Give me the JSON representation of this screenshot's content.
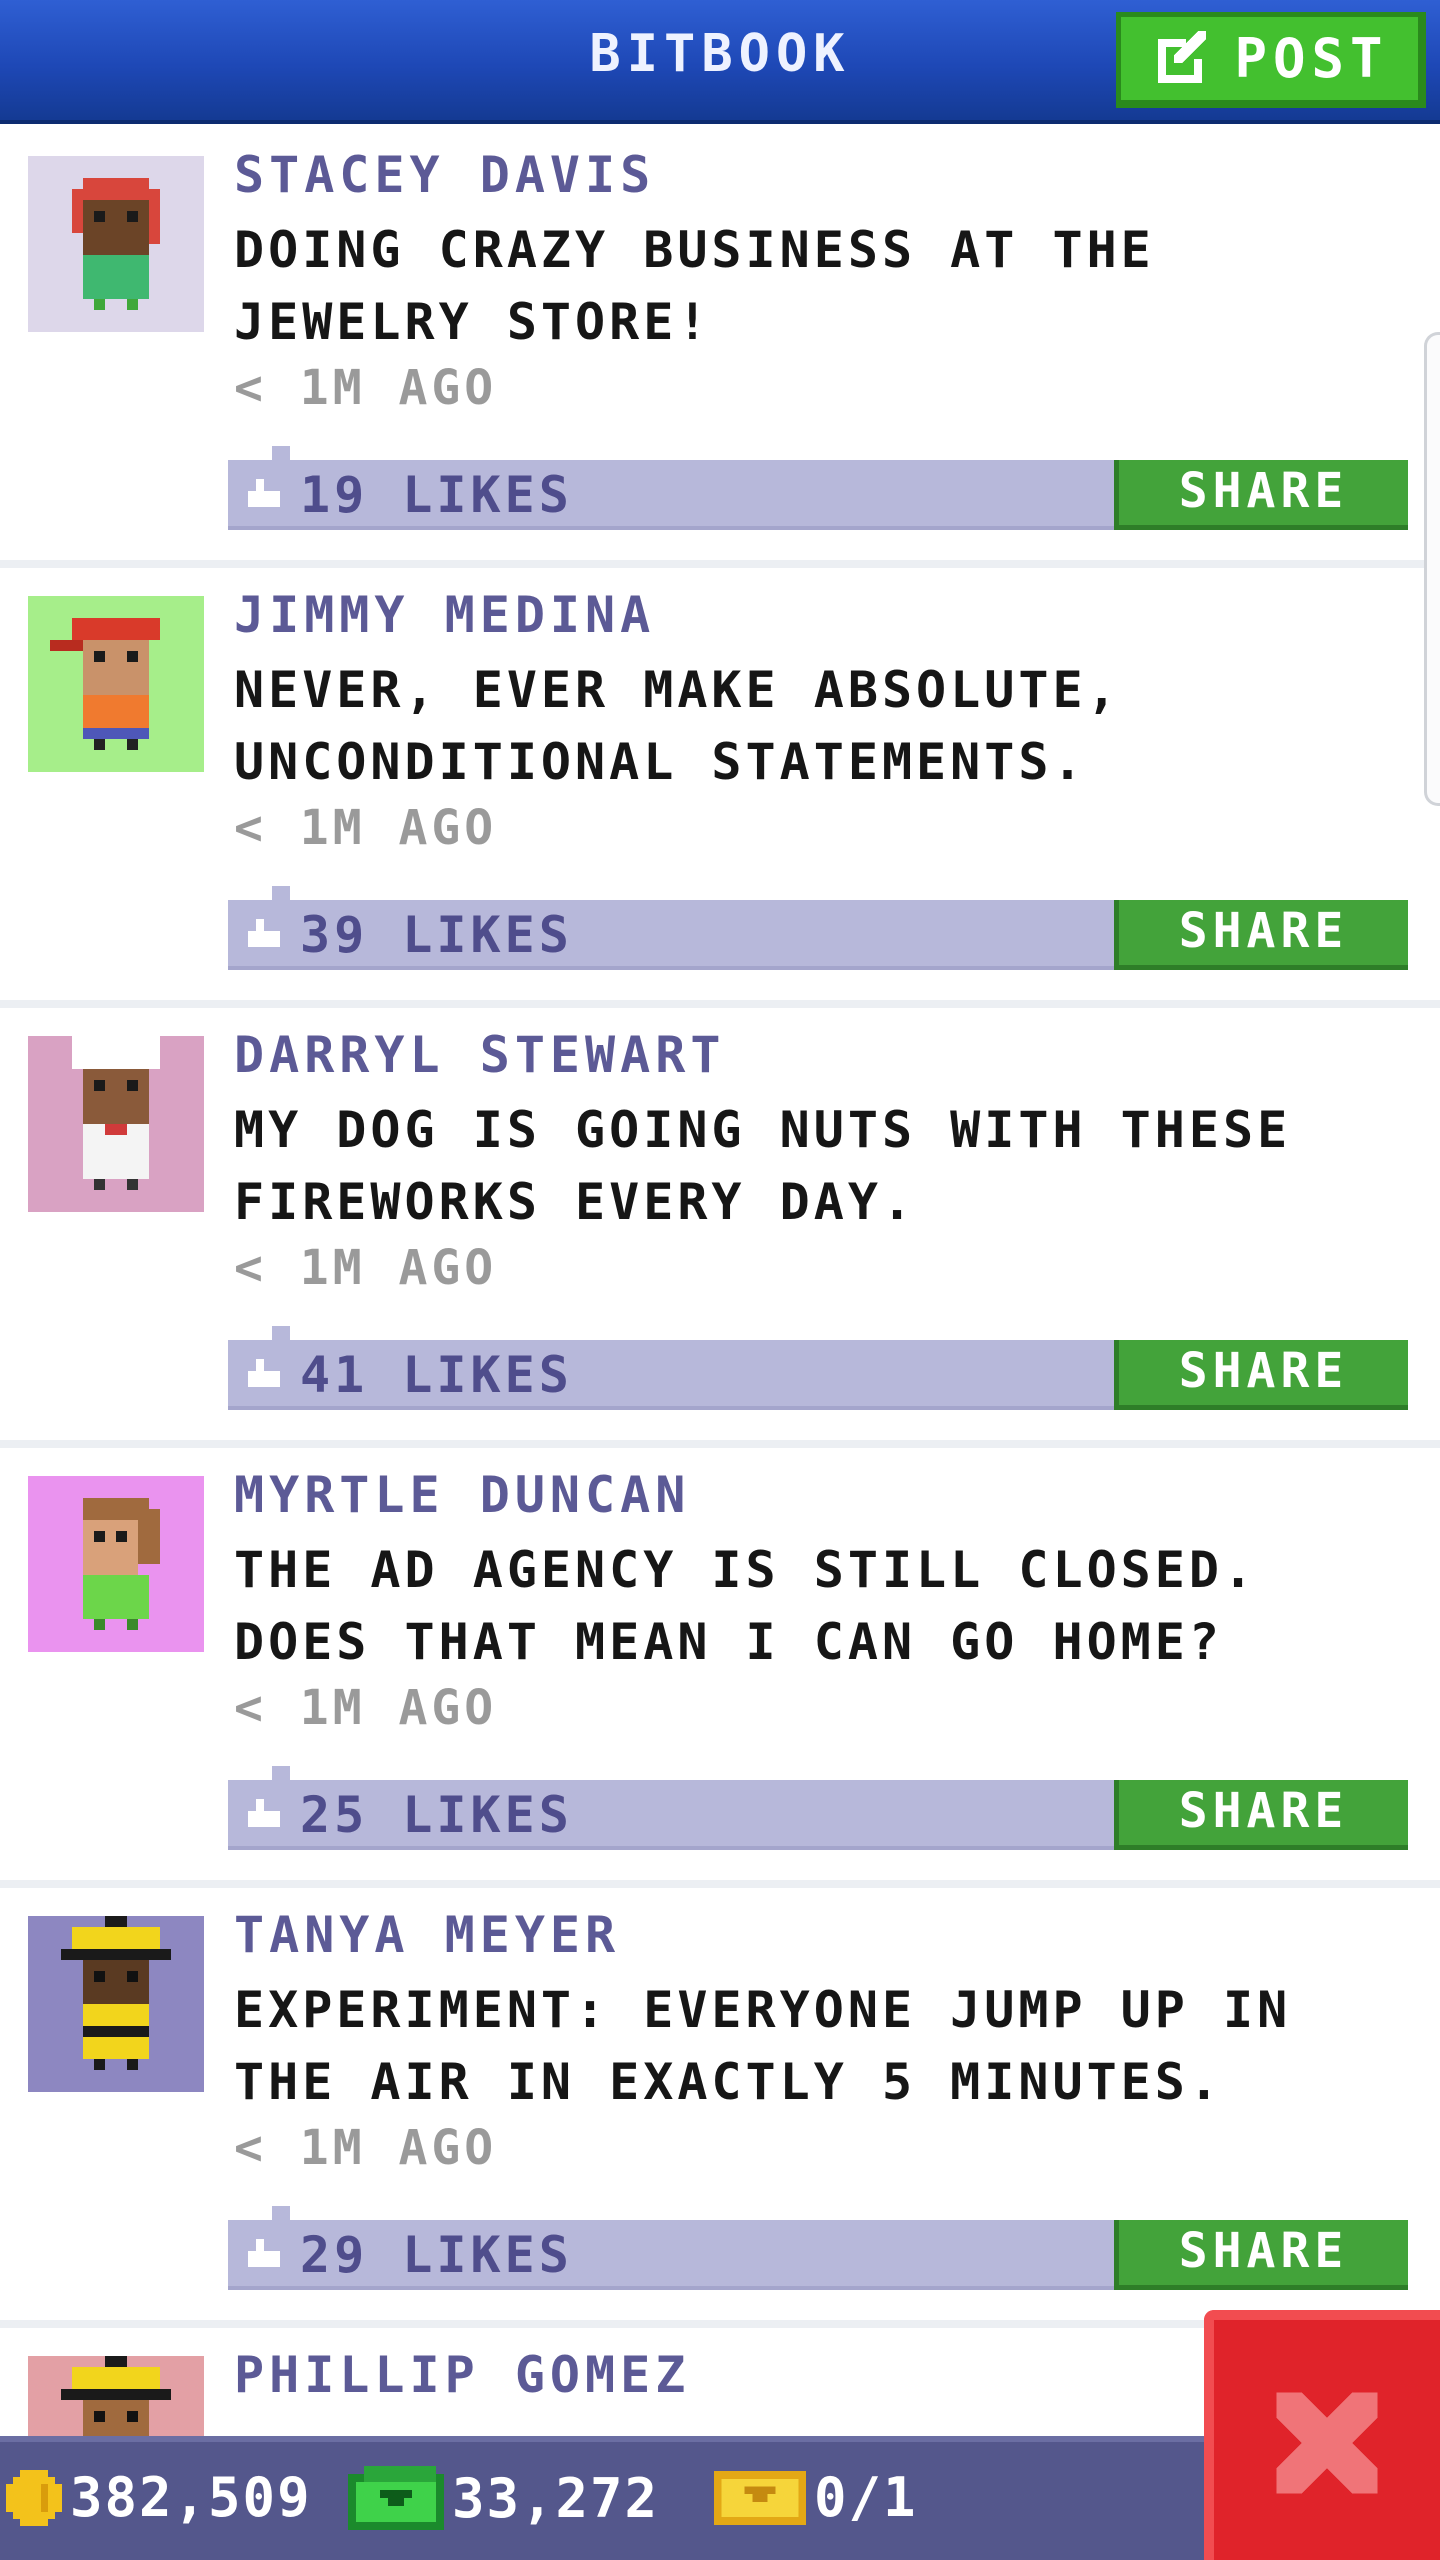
{
  "header": {
    "title": "BITBOOK",
    "post_label": "POST"
  },
  "posts": [
    {
      "name": "STACEY DAVIS",
      "message": "DOING CRAZY BUSINESS AT THE JEWELRY STORE!",
      "time": "< 1M AGO",
      "likes": "19 LIKES",
      "share": "SHARE",
      "avatar_bg": "#ddd7ea"
    },
    {
      "name": "JIMMY MEDINA",
      "message": "NEVER, EVER MAKE ABSOLUTE, UNCONDITIONAL STATEMENTS.",
      "time": "< 1M AGO",
      "likes": "39 LIKES",
      "share": "SHARE",
      "avatar_bg": "#a6ee8a"
    },
    {
      "name": "DARRYL STEWART",
      "message": "MY DOG IS GOING NUTS WITH THESE FIREWORKS EVERY DAY.",
      "time": "< 1M AGO",
      "likes": "41 LIKES",
      "share": "SHARE",
      "avatar_bg": "#d9a2c3"
    },
    {
      "name": "MYRTLE DUNCAN",
      "message": "THE AD AGENCY IS STILL CLOSED. DOES THAT MEAN I CAN GO HOME?",
      "time": "< 1M AGO",
      "likes": "25 LIKES",
      "share": "SHARE",
      "avatar_bg": "#ea93ef"
    },
    {
      "name": "TANYA MEYER",
      "message": "EXPERIMENT: EVERYONE JUMP UP IN THE AIR IN EXACTLY 5 MINUTES.",
      "time": "< 1M AGO",
      "likes": "29 LIKES",
      "share": "SHARE",
      "avatar_bg": "#8d87c1"
    },
    {
      "name": "PHILLIP GOMEZ",
      "avatar_bg": "#e3a0a5"
    }
  ],
  "status": {
    "coins": "382,509",
    "bux": "33,272",
    "tickets": "0/1"
  },
  "colors": {
    "header": "#1e48b6",
    "accent_green": "#43a33a",
    "likes_bar": "#b7b8da",
    "name_text": "#5c5a96",
    "close_red": "#e0232a"
  },
  "icons": {
    "post": "edit-icon",
    "likes": "thumbs-up-icon",
    "coins": "coin-icon",
    "bux": "bux-icon",
    "tickets": "ticket-icon",
    "close": "close-icon"
  }
}
